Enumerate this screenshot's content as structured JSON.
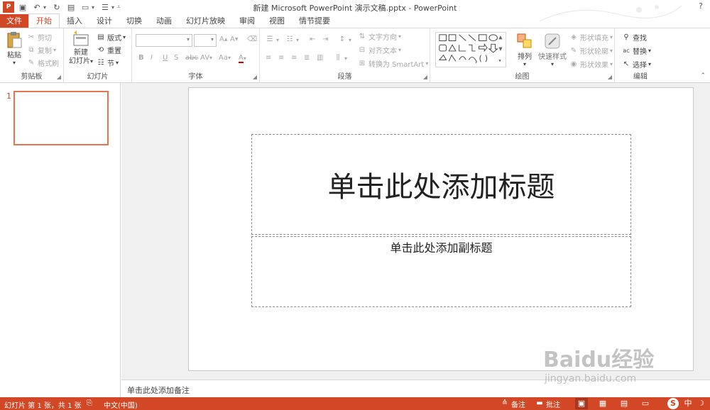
{
  "window": {
    "title": "新建 Microsoft PowerPoint 演示文稿.pptx - PowerPoint",
    "help": "?"
  },
  "tabs": [
    {
      "label": "文件"
    },
    {
      "label": "开始"
    },
    {
      "label": "插入"
    },
    {
      "label": "设计"
    },
    {
      "label": "切换"
    },
    {
      "label": "动画"
    },
    {
      "label": "幻灯片放映"
    },
    {
      "label": "审阅"
    },
    {
      "label": "视图"
    },
    {
      "label": "情节提要"
    }
  ],
  "ribbon": {
    "clipboard": {
      "label": "剪贴板",
      "paste": "粘贴",
      "cut": "剪切",
      "copy": "复制",
      "format_painter": "格式刷"
    },
    "slides": {
      "label": "幻灯片",
      "new_slide_1": "新建",
      "new_slide_2": "幻灯片",
      "layout": "版式",
      "reset": "重置",
      "section": "节"
    },
    "font": {
      "label": "字体",
      "bold": "B",
      "italic": "I",
      "underline": "U",
      "strike": "S",
      "abc": "abc",
      "spacing": "AV",
      "case": "Aa"
    },
    "paragraph": {
      "label": "段落",
      "text_direction": "文字方向",
      "align_text": "对齐文本",
      "smartart": "转换为 SmartArt"
    },
    "drawing": {
      "label": "绘图",
      "arrange": "排列",
      "quick_styles": "快速样式",
      "fill": "形状填充",
      "outline": "形状轮廓",
      "effects": "形状效果"
    },
    "editing": {
      "label": "编辑",
      "find": "查找",
      "replace": "替换",
      "select": "选择"
    }
  },
  "thumbnails": {
    "slide_number": "1"
  },
  "slide": {
    "title_placeholder": "单击此处添加标题",
    "subtitle_placeholder": "单击此处添加副标题"
  },
  "notes": {
    "placeholder": "单击此处添加备注"
  },
  "statusbar": {
    "slide_info": "幻灯片 第 1 张，共 1 张",
    "language": "中文(中国)",
    "notes_btn": "备注",
    "comments_btn": "批注"
  },
  "watermark": {
    "logo": "Baidu经验",
    "url": "jingyan.baidu.com"
  },
  "colors": {
    "accent": "#d24726",
    "active_tab": "#d24726"
  }
}
